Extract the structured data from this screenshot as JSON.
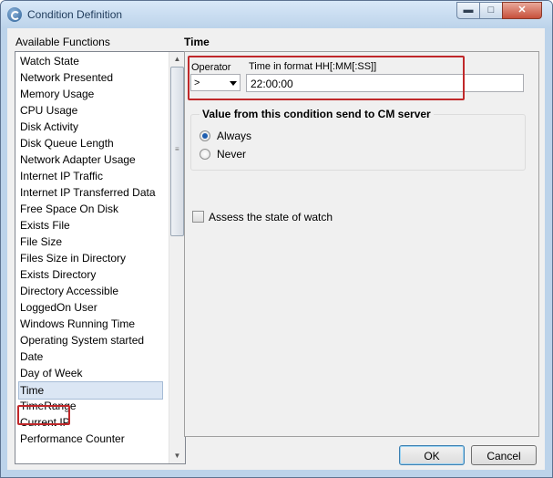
{
  "window": {
    "title": "Condition Definition"
  },
  "titlebar": {
    "min_glyph": "▬",
    "max_glyph": "□",
    "close_glyph": "✕"
  },
  "functions": {
    "label": "Available Functions",
    "items": [
      "Watch State",
      "Network Presented",
      "Memory Usage",
      "CPU Usage",
      "Disk Activity",
      "Disk Queue Length",
      "Network Adapter Usage",
      "Internet IP Traffic",
      "Internet IP Transferred Data",
      "Free Space On Disk",
      "Exists File",
      "File Size",
      "Files Size in Directory",
      "Exists Directory",
      "Directory Accessible",
      "LoggedOn User",
      "Windows Running Time",
      "Operating System started",
      "Date",
      "Day of Week",
      "Time",
      "TimeRange",
      "Current IP",
      "Performance Counter"
    ],
    "selected": "Time"
  },
  "detail": {
    "title": "Time",
    "operator_label": "Operator",
    "operator_value": ">",
    "time_label": "Time in format HH[:MM[:SS]]",
    "time_value": "22:00:00",
    "send_group_title": "Value from this condition send to CM server",
    "option_always": "Always",
    "option_never": "Never",
    "selected_option": "Always",
    "assess_label": "Assess the state of watch",
    "assess_checked": false
  },
  "buttons": {
    "ok": "OK",
    "cancel": "Cancel"
  },
  "scrollbar": {
    "up_glyph": "▲",
    "down_glyph": "▼",
    "grip_glyph": "≡"
  }
}
